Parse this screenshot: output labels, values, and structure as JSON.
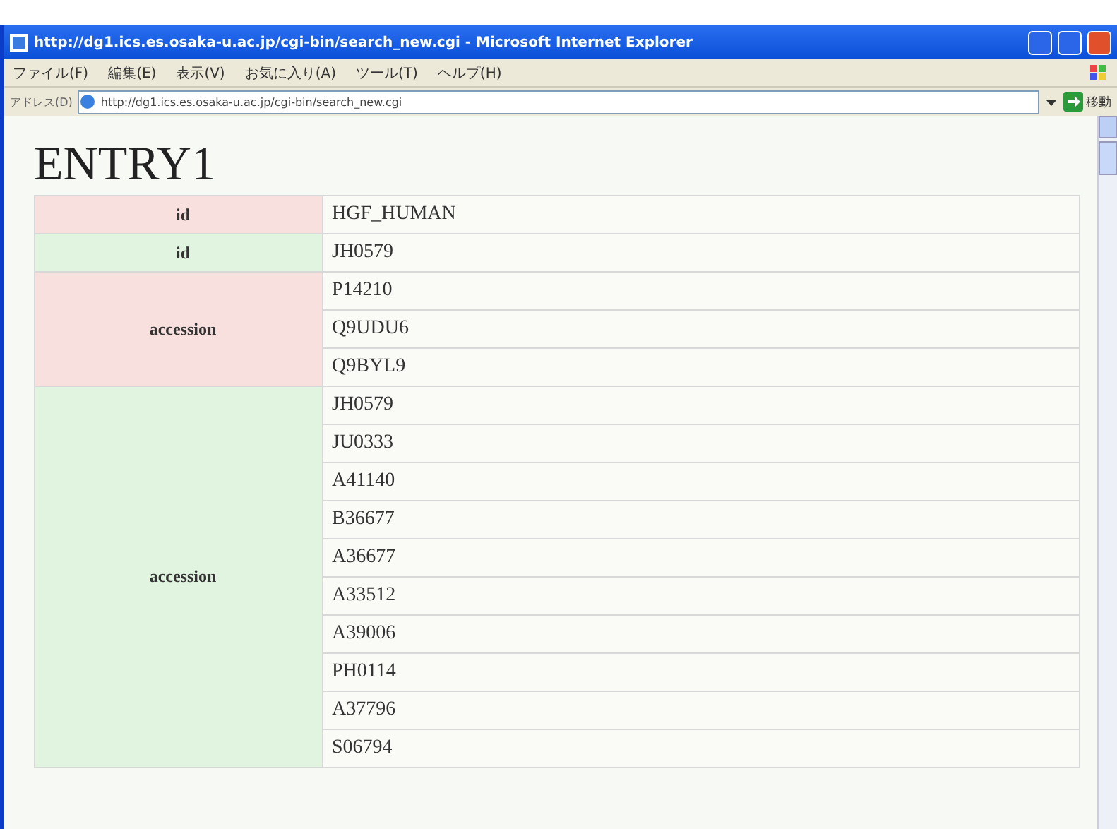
{
  "window": {
    "title": "http://dg1.ics.es.osaka-u.ac.jp/cgi-bin/search_new.cgi - Microsoft Internet Explorer"
  },
  "menu": [
    "ファイル(F)",
    "編集(E)",
    "表示(V)",
    "お気に入り(A)",
    "ツール(T)",
    "ヘルプ(H)"
  ],
  "address_bar": {
    "label": "アドレス(D)",
    "value": "http://dg1.ics.es.osaka-u.ac.jp/cgi-bin/search_new.cgi",
    "go": "移動"
  },
  "heading": "ENTRY1",
  "table": {
    "groups": [
      {
        "label": "id",
        "color": "#f8e0de",
        "values": [
          "HGF_HUMAN"
        ]
      },
      {
        "label": "id",
        "color": "#e0f4e0",
        "values": [
          "JH0579"
        ]
      },
      {
        "label": "accession",
        "color": "#f8e0de",
        "values": [
          "P14210",
          "Q9UDU6",
          "Q9BYL9"
        ]
      },
      {
        "label": "accession",
        "color": "#e0f4e0",
        "values": [
          "JH0579",
          "JU0333",
          "A41140",
          "B36677",
          "A36677",
          "A33512",
          "A39006",
          "PH0114",
          "A37796",
          "S06794"
        ]
      }
    ]
  }
}
